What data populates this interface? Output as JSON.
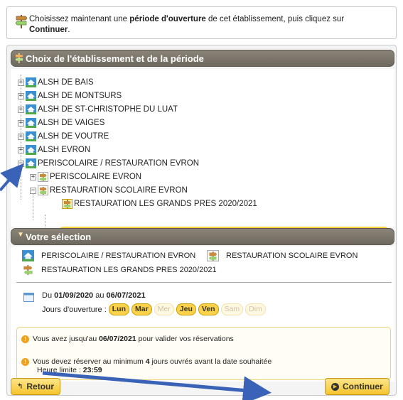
{
  "intro": {
    "text_before": "Choisissez maintenant une ",
    "text_bold": "période d'ouverture",
    "text_after": " de cet établissement, puis cliquez sur",
    "continue_bold": "Continuer",
    "end": "."
  },
  "tree_section": {
    "title": "Choix de l'établissement et de la période",
    "nodes": [
      {
        "label": "ALSH DE BAIS",
        "expander": "+"
      },
      {
        "label": "ALSH DE MONTSURS",
        "expander": "+"
      },
      {
        "label": "ALSH DE ST-CHRISTOPHE DU LUAT",
        "expander": "+"
      },
      {
        "label": "ALSH DE VAIGES",
        "expander": "+"
      },
      {
        "label": "ALSH DE VOUTRE",
        "expander": "+"
      },
      {
        "label": "ALSH EVRON",
        "expander": "+"
      },
      {
        "label": "PERISCOLAIRE / RESTAURATION EVRON",
        "expander": "−"
      },
      {
        "label": "PERISCOLAIRE EVRON",
        "expander": "+"
      },
      {
        "label": "RESTAURATION SCOLAIRE EVRON",
        "expander": "−"
      },
      {
        "label": "RESTAURATION LES GRANDS PRES 2020/2021",
        "expander": ""
      }
    ]
  },
  "selection_section": {
    "title": "Votre sélection",
    "establishment": "PERISCOLAIRE / RESTAURATION EVRON",
    "activity": "RESTAURATION SCOLAIRE EVRON",
    "period": "RESTAURATION LES GRANDS PRES 2020/2021",
    "dates": {
      "from_prefix": "Du ",
      "from": "01/09/2020",
      "to_prefix": " au ",
      "to": "06/07/2021"
    },
    "days_label": "Jours d'ouverture : ",
    "days": [
      {
        "label": "Lun",
        "open": true
      },
      {
        "label": "Mar",
        "open": true
      },
      {
        "label": "Mer",
        "open": false
      },
      {
        "label": "Jeu",
        "open": true
      },
      {
        "label": "Ven",
        "open": true
      },
      {
        "label": "Sam",
        "open": false
      },
      {
        "label": "Dim",
        "open": false
      }
    ],
    "info1_before": "Vous avez jusqu'au ",
    "info1_bold": "06/07/2021",
    "info1_after": " pour valider vos réservations",
    "info2_before": "Vous devez réserver au minimum ",
    "info2_bold": "4",
    "info2_after": " jours ouvrés avant la date souhaitée",
    "info3_label": "Heure limite : ",
    "info3_bold": "23:59"
  },
  "buttons": {
    "back": "Retour",
    "continue": "Continuer"
  },
  "colors": {
    "accent": "#f8d13a",
    "header": "#7a7468",
    "arrow": "#3a63b8"
  }
}
